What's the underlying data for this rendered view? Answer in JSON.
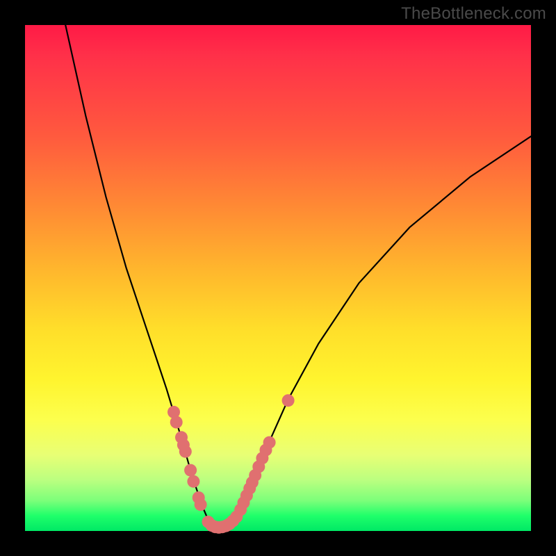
{
  "watermark": "TheBottleneck.com",
  "colors": {
    "background": "#000000",
    "curve": "#000000",
    "dot": "#e07070",
    "gradient_top": "#ff1a46",
    "gradient_bottom": "#00e865"
  },
  "chart_data": {
    "type": "line",
    "title": "",
    "xlabel": "",
    "ylabel": "",
    "xlim": [
      0,
      100
    ],
    "ylim": [
      0,
      100
    ],
    "series": [
      {
        "name": "bottleneck-curve",
        "x": [
          8,
          12,
          16,
          20,
          24,
          26,
          28,
          29.5,
          31,
          33,
          35,
          36.5,
          37.5,
          38.5,
          40,
          42,
          44,
          46,
          48,
          52,
          58,
          66,
          76,
          88,
          100
        ],
        "y": [
          100,
          82,
          66,
          52,
          40,
          34,
          28,
          23,
          18,
          11,
          5,
          1.5,
          0.7,
          0.7,
          1.2,
          3,
          7,
          12,
          17,
          26,
          37,
          49,
          60,
          70,
          78
        ]
      }
    ],
    "dot_clusters": [
      {
        "name": "left-arm-dots",
        "points": [
          {
            "x": 29.4,
            "y": 23.5
          },
          {
            "x": 29.9,
            "y": 21.5
          },
          {
            "x": 30.9,
            "y": 18.5
          },
          {
            "x": 31.3,
            "y": 17.0
          },
          {
            "x": 31.7,
            "y": 15.7
          },
          {
            "x": 32.7,
            "y": 12.0
          },
          {
            "x": 33.3,
            "y": 9.8
          },
          {
            "x": 34.3,
            "y": 6.6
          },
          {
            "x": 34.7,
            "y": 5.2
          }
        ]
      },
      {
        "name": "right-arm-dots",
        "points": [
          {
            "x": 41.8,
            "y": 2.8
          },
          {
            "x": 42.6,
            "y": 4.2
          },
          {
            "x": 43.2,
            "y": 5.6
          },
          {
            "x": 43.8,
            "y": 7.0
          },
          {
            "x": 44.4,
            "y": 8.4
          },
          {
            "x": 44.9,
            "y": 9.6
          },
          {
            "x": 45.5,
            "y": 11.0
          },
          {
            "x": 46.2,
            "y": 12.7
          },
          {
            "x": 46.9,
            "y": 14.4
          },
          {
            "x": 47.6,
            "y": 16.0
          },
          {
            "x": 48.3,
            "y": 17.5
          },
          {
            "x": 52.0,
            "y": 25.8
          }
        ]
      },
      {
        "name": "bottom-dots",
        "points": [
          {
            "x": 36.2,
            "y": 1.8
          },
          {
            "x": 36.9,
            "y": 1.1
          },
          {
            "x": 37.6,
            "y": 0.8
          },
          {
            "x": 38.3,
            "y": 0.7
          },
          {
            "x": 39.0,
            "y": 0.8
          },
          {
            "x": 39.7,
            "y": 1.0
          },
          {
            "x": 40.4,
            "y": 1.4
          },
          {
            "x": 41.1,
            "y": 2.0
          }
        ]
      }
    ]
  }
}
